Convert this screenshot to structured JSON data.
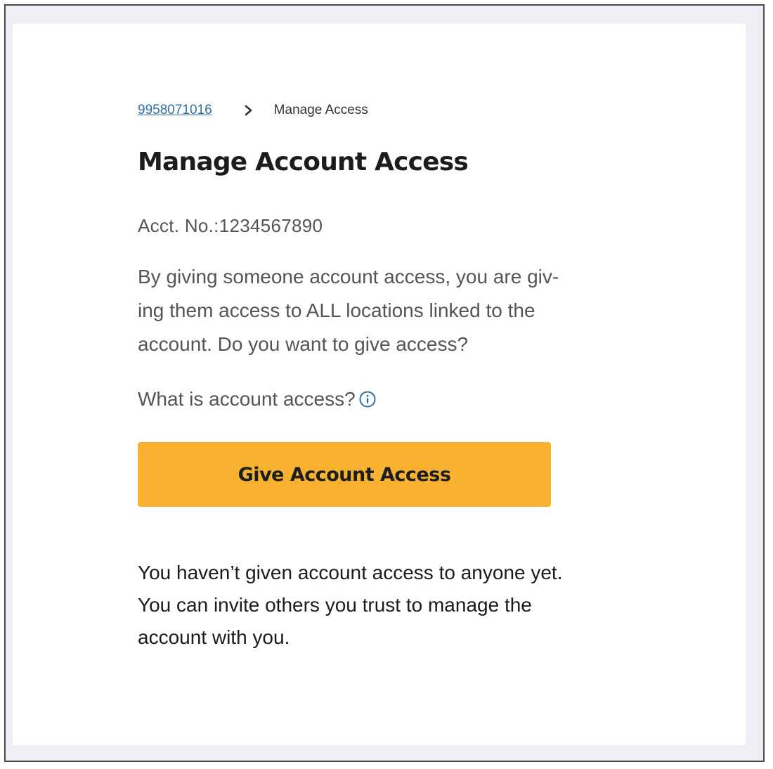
{
  "breadcrumb": {
    "link_label": "9958071016",
    "separator_icon": "chevron-right-icon",
    "current_label": "Manage Access"
  },
  "page": {
    "title": "Manage Account Access",
    "account_number": "Acct. No.:1234567890",
    "warning_lines": [
      "By giving someone account access, you are giv-",
      "ing them access to ALL locations linked to the",
      "account. Do you want to give access?"
    ],
    "what_is_label": "What is account access?",
    "info_icon": "info-circle-icon",
    "give_access_button": "Give Account Access",
    "empty_message_lines": [
      "You haven’t given account access to anyone yet.",
      "You can invite others you trust to manage the",
      "account with you."
    ]
  },
  "colors": {
    "accent_button": "#f8b22f",
    "link": "#2f6fa8",
    "frame_background": "#eeeef4"
  }
}
